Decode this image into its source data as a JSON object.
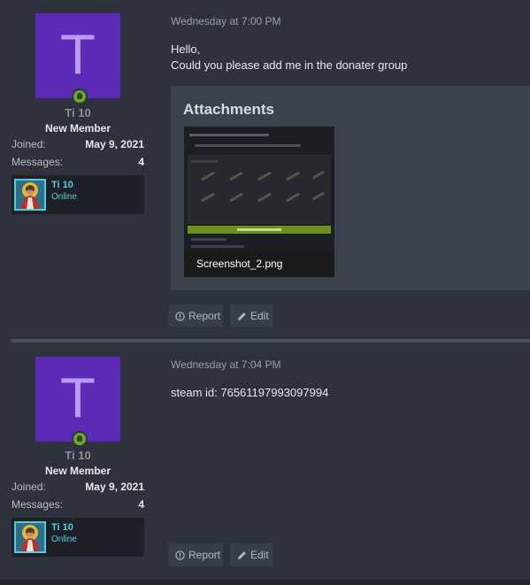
{
  "posts": [
    {
      "author": {
        "avatar_letter": "T",
        "name": "Ti 10",
        "title": "New Member",
        "joined_label": "Joined:",
        "joined_value": "May 9, 2021",
        "messages_label": "Messages:",
        "messages_value": "4",
        "steam_name": "Ti 10",
        "steam_status": "Online"
      },
      "timestamp": "Wednesday at 7:00 PM",
      "message_lines": [
        "Hello,",
        "Could you please add me in the donater group"
      ],
      "attachments_title": "Attachments",
      "attachment_file": "Screenshot_2.png",
      "report_label": "Report",
      "edit_label": "Edit"
    },
    {
      "author": {
        "avatar_letter": "T",
        "name": "Ti 10",
        "title": "New Member",
        "joined_label": "Joined:",
        "joined_value": "May 9, 2021",
        "messages_label": "Messages:",
        "messages_value": "4",
        "steam_name": "Ti 10",
        "steam_status": "Online"
      },
      "timestamp": "Wednesday at 7:04 PM",
      "message_lines": [
        "steam id: 76561197993097994"
      ],
      "report_label": "Report",
      "edit_label": "Edit"
    }
  ],
  "colors": {
    "avatar_bg": "#5b2bb5",
    "online": "#6aa72c",
    "steam_accent": "#57cbde",
    "background": "#2d323d"
  },
  "icons": [
    "online-status-icon",
    "report-icon",
    "edit-icon"
  ]
}
